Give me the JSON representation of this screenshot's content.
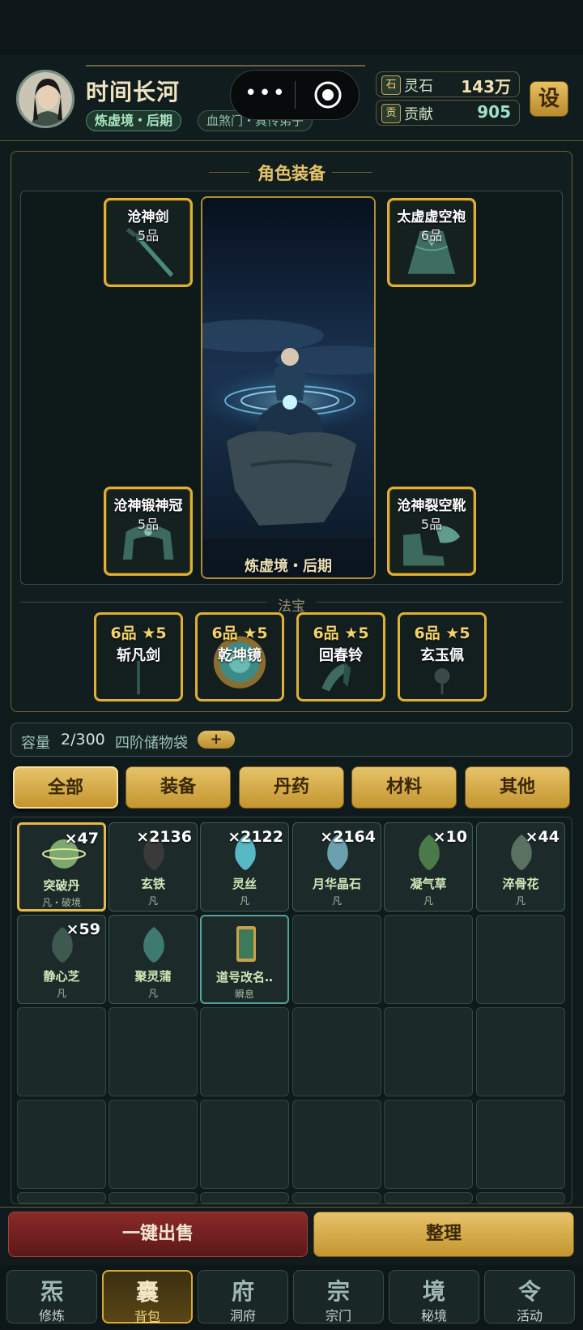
{
  "header": {
    "name": "时间长河",
    "realm": "炼虚境・后期",
    "sect": "血煞门・真传弟子",
    "more_glyph": "•••",
    "settings": "设"
  },
  "resources": {
    "stone": {
      "icon": "石",
      "label": "灵石",
      "value": "143万",
      "color": "#f3e2b0"
    },
    "contribution": {
      "icon": "贡",
      "label": "贡献",
      "value": "905",
      "color": "#9ee0c6"
    }
  },
  "equipment": {
    "title": "角色装备",
    "portrait_label": "炼虚境・后期",
    "slots": [
      {
        "name": "沧神剑",
        "grade": "5品",
        "icon": "sword-icon"
      },
      {
        "name": "太虚虚空袍",
        "grade": "6品",
        "icon": "robe-icon"
      },
      {
        "name": "沧神锻神冠",
        "grade": "5品",
        "icon": "crown-icon"
      },
      {
        "name": "沧神裂空靴",
        "grade": "5品",
        "icon": "boots-icon"
      }
    ]
  },
  "treasures": {
    "label": "法宝",
    "items": [
      {
        "grade": "6品 ★5",
        "name": "斩凡剑",
        "icon": "sword-icon"
      },
      {
        "grade": "6品 ★5",
        "name": "乾坤镜",
        "icon": "mirror-icon"
      },
      {
        "grade": "6品 ★5",
        "name": "回春铃",
        "icon": "bell-icon"
      },
      {
        "grade": "6品 ★5",
        "name": "玄玉佩",
        "icon": "jade-pendant-icon"
      }
    ]
  },
  "capacity": {
    "label": "容量",
    "value": "2/300",
    "bag": "四阶储物袋",
    "plus": "+"
  },
  "filters": [
    "全部",
    "装备",
    "丹药",
    "材料",
    "其他"
  ],
  "inventory": [
    {
      "name": "突破丹",
      "qty": "×47",
      "rank": "凡・破境",
      "icon": "pill-icon"
    },
    {
      "name": "玄铁",
      "qty": "×2136",
      "rank": "凡",
      "icon": "iron-ore-icon"
    },
    {
      "name": "灵丝",
      "qty": "×2122",
      "rank": "凡",
      "icon": "silk-icon"
    },
    {
      "name": "月华晶石",
      "qty": "×2164",
      "rank": "凡",
      "icon": "crystal-icon"
    },
    {
      "name": "凝气草",
      "qty": "×10",
      "rank": "凡",
      "icon": "herb-icon"
    },
    {
      "name": "淬骨花",
      "qty": "×44",
      "rank": "凡",
      "icon": "flower-icon"
    },
    {
      "name": "静心芝",
      "qty": "×59",
      "rank": "凡",
      "icon": "mushroom-icon"
    },
    {
      "name": "聚灵蒲",
      "qty": "",
      "rank": "凡",
      "icon": "reed-icon"
    },
    {
      "name": "道号改名‥",
      "qty": "",
      "rank": "瞬息",
      "icon": "card-icon"
    }
  ],
  "actions": {
    "sell": "一键出售",
    "sort": "整理"
  },
  "nav": [
    {
      "glyph": "炁",
      "label": "修炼"
    },
    {
      "glyph": "囊",
      "label": "背包"
    },
    {
      "glyph": "府",
      "label": "洞府"
    },
    {
      "glyph": "宗",
      "label": "宗门"
    },
    {
      "glyph": "境",
      "label": "秘境"
    },
    {
      "glyph": "令",
      "label": "活动"
    }
  ]
}
